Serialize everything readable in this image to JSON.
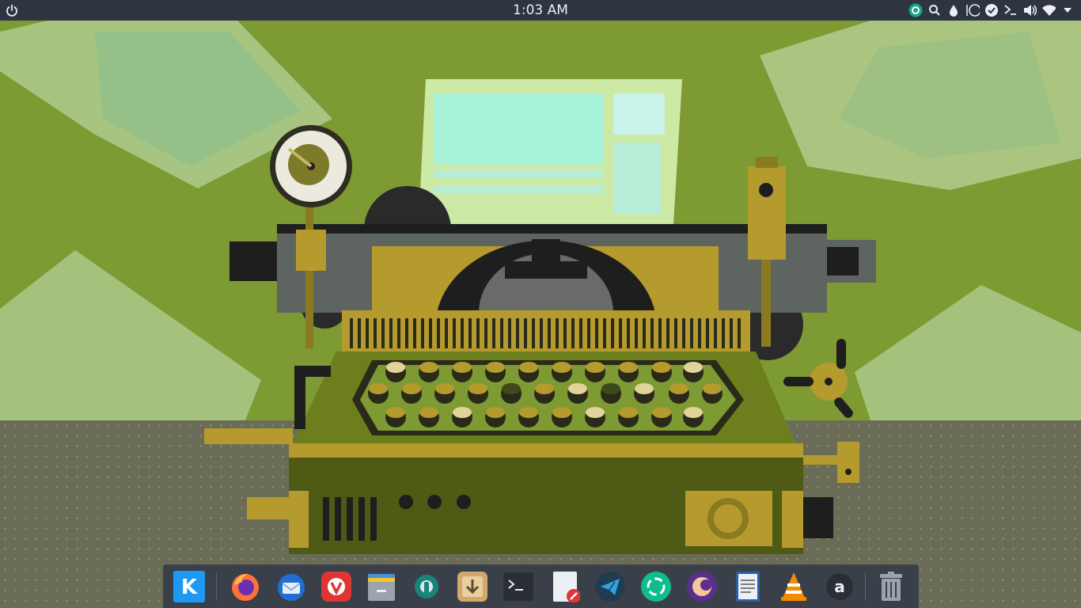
{
  "top_panel": {
    "clock": "1:03 AM",
    "left_icon": "power-icon",
    "tray_icons": [
      "app-store-icon",
      "search-icon",
      "droplet-icon",
      "circle-icon",
      "check-icon",
      "terminal-prompt-icon",
      "volume-icon",
      "wifi-icon",
      "menu-arrow-icon"
    ]
  },
  "dock": {
    "items": [
      {
        "name": "kde-launcher",
        "icon": "kde-icon"
      },
      {
        "name": "firefox",
        "icon": "firefox-icon"
      },
      {
        "name": "thunderbird",
        "icon": "thunderbird-icon"
      },
      {
        "name": "vivaldi",
        "icon": "vivaldi-icon"
      },
      {
        "name": "file-manager",
        "icon": "folder-stack-icon"
      },
      {
        "name": "settings",
        "icon": "settings-gear-icon"
      },
      {
        "name": "downloader",
        "icon": "download-icon"
      },
      {
        "name": "terminal",
        "icon": "terminal-icon"
      },
      {
        "name": "text-editor",
        "icon": "document-edit-icon"
      },
      {
        "name": "telegram",
        "icon": "telegram-icon"
      },
      {
        "name": "element",
        "icon": "element-icon"
      },
      {
        "name": "media-app",
        "icon": "circle-app-icon"
      },
      {
        "name": "document-viewer",
        "icon": "document-icon"
      },
      {
        "name": "vlc",
        "icon": "vlc-icon"
      },
      {
        "name": "amazon",
        "icon": "amazon-icon"
      },
      {
        "name": "trash",
        "icon": "trash-icon"
      }
    ]
  },
  "colors": {
    "panel_bg": "#2e3440",
    "dock_bg": "#3a404a",
    "wall": "#7e9a32",
    "floor": "#6b6c58",
    "brass": "#b59a2e"
  }
}
